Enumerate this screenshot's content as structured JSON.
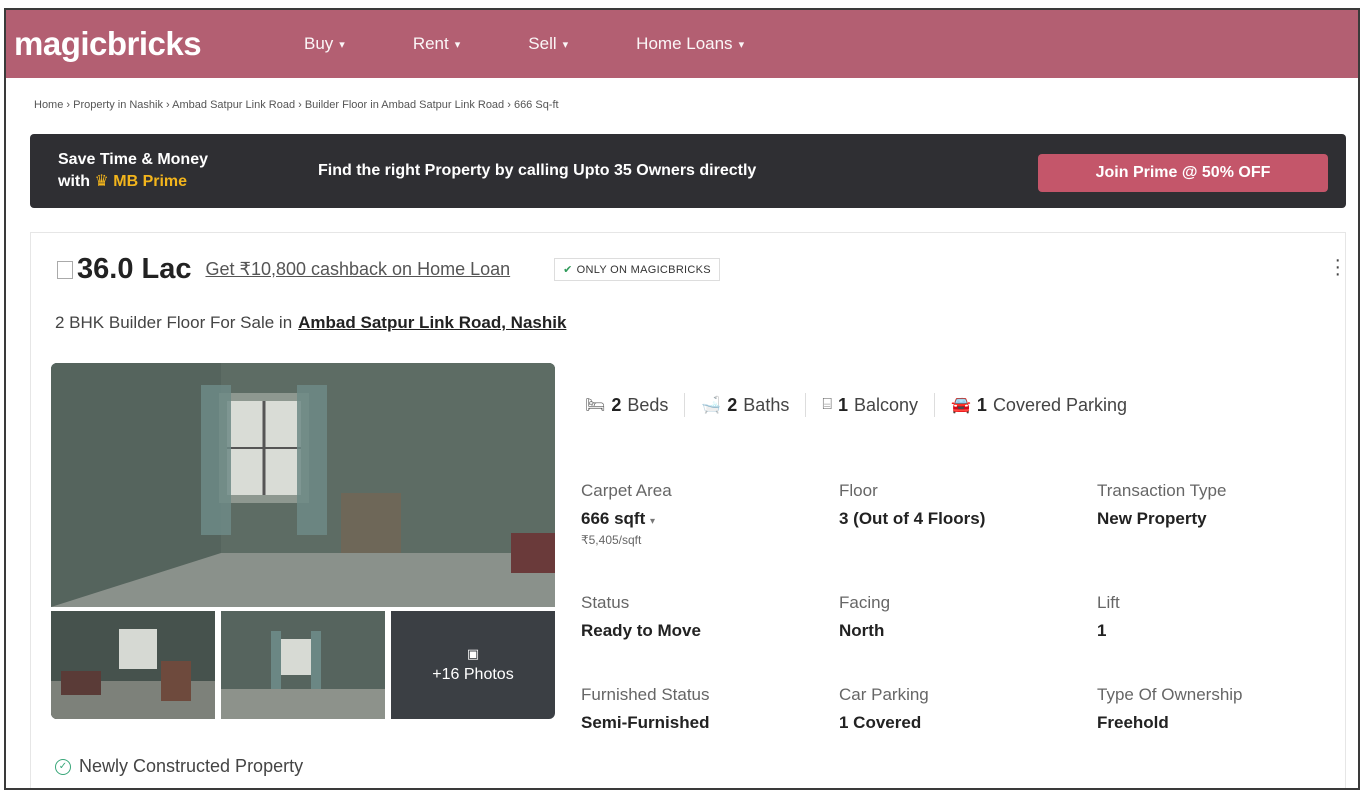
{
  "header": {
    "logo": "magicbricks",
    "nav": [
      {
        "label": "Buy"
      },
      {
        "label": "Rent"
      },
      {
        "label": "Sell"
      },
      {
        "label": "Home Loans"
      }
    ]
  },
  "breadcrumb": "Home › Property in Nashik › Ambad Satpur Link Road › Builder Floor in Ambad Satpur Link Road › 666 Sq-ft",
  "prime_banner": {
    "line1": "Save Time & Money",
    "line2_prefix": "with",
    "line2_brand": "MB Prime",
    "message": "Find the right Property by calling Upto 35 Owners directly",
    "cta": "Join Prime @ 50% OFF"
  },
  "listing": {
    "price": "36.0 Lac",
    "cashback": "Get ₹10,800 cashback on Home Loan",
    "badge": "ONLY ON MAGICBRICKS",
    "title_prefix": "2 BHK Builder Floor For Sale in",
    "location": "Ambad Satpur Link Road, Nashik",
    "photos_more": "+16 Photos",
    "amenities": [
      {
        "value": "2",
        "label": "Beds",
        "icon": "bed-icon"
      },
      {
        "value": "2",
        "label": "Baths",
        "icon": "bath-icon"
      },
      {
        "value": "1",
        "label": "Balcony",
        "icon": "balcony-icon"
      },
      {
        "value": "1",
        "label": "Covered Parking",
        "icon": "parking-icon"
      }
    ],
    "details": {
      "carpet_area": {
        "label": "Carpet Area",
        "value": "666 sqft",
        "sub": "₹5,405/sqft"
      },
      "floor": {
        "label": "Floor",
        "value": "3 (Out of 4 Floors)"
      },
      "transaction": {
        "label": "Transaction Type",
        "value": "New Property"
      },
      "status": {
        "label": "Status",
        "value": "Ready to Move"
      },
      "facing": {
        "label": "Facing",
        "value": "North"
      },
      "lift": {
        "label": "Lift",
        "value": "1"
      },
      "furnished": {
        "label": "Furnished Status",
        "value": "Semi-Furnished"
      },
      "car_parking": {
        "label": "Car Parking",
        "value": "1 Covered"
      },
      "ownership": {
        "label": "Type Of Ownership",
        "value": "Freehold"
      }
    },
    "tag": "Newly Constructed Property"
  },
  "colors": {
    "header": "#b35f72",
    "banner": "#2f2f33",
    "cta": "#c4566a",
    "prime_gold": "#f3b51c"
  }
}
